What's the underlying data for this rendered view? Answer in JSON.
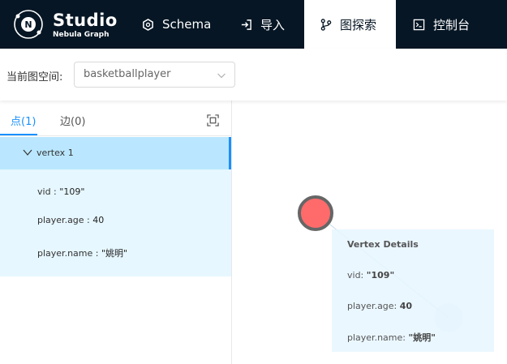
{
  "app": {
    "title": "Studio",
    "subtitle": "Nebula Graph"
  },
  "nav": {
    "items": [
      {
        "label": "Schema",
        "icon": "schema-icon"
      },
      {
        "label": "导入",
        "icon": "import-icon"
      },
      {
        "label": "图探索",
        "icon": "explore-icon",
        "active": true
      },
      {
        "label": "控制台",
        "icon": "console-icon"
      }
    ]
  },
  "space": {
    "label": "当前图空间:",
    "selected": "basketballplayer"
  },
  "panel": {
    "tabs": [
      {
        "label": "点(1)",
        "active": true
      },
      {
        "label": "边(0)"
      }
    ],
    "vertex": {
      "title": "vertex 1",
      "props": [
        {
          "key": "vid :",
          "value": "\"109\""
        },
        {
          "key": "player.age :",
          "value": "40"
        },
        {
          "key": "player.name :",
          "value": "\"姚明\""
        }
      ]
    }
  },
  "details": {
    "title": "Vertex Details",
    "rows": [
      {
        "key": "vid:",
        "value": "\"109\""
      },
      {
        "key": "player.age:",
        "value": "40"
      },
      {
        "key": "player.name:",
        "value": "\"姚明\""
      }
    ]
  },
  "colors": {
    "header_bg": "#061624",
    "accent": "#1890ff",
    "node_fill": "#ff6b6b",
    "selected_row": "#bae7ff",
    "props_bg": "#e6f7ff"
  }
}
